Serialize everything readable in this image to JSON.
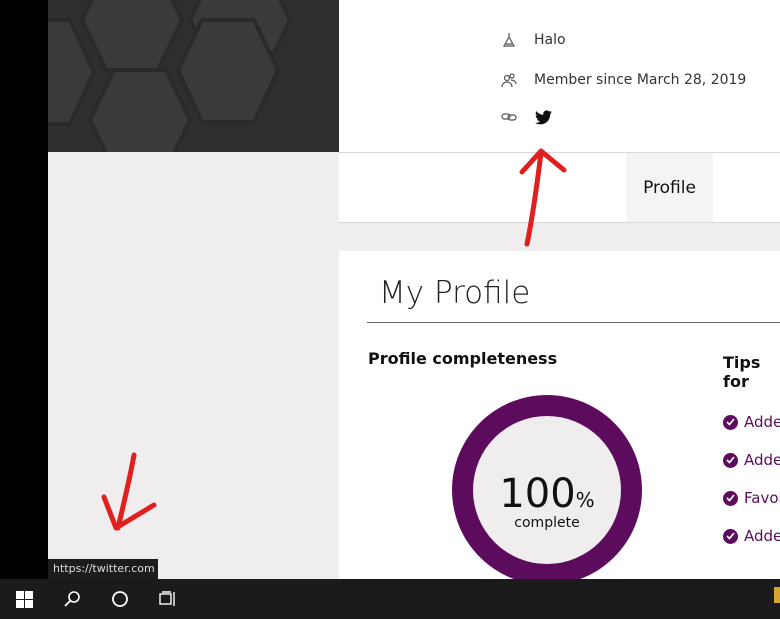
{
  "profile_info": {
    "game": "Halo",
    "member_since": "Member since March 28, 2019"
  },
  "tabs": [
    {
      "label": "Profile"
    }
  ],
  "my_profile": {
    "title": "My Profile",
    "completeness_label": "Profile completeness",
    "percent": "100",
    "percent_sign": "%",
    "complete_label": "complete",
    "tips_label": "Tips for",
    "tips": [
      "Adde",
      "Adde",
      "Favor",
      "Adde"
    ]
  },
  "status_tooltip": "https://twitter.com",
  "colors": {
    "accent": "#5d0b5c",
    "annotation": "#e01f1f"
  }
}
